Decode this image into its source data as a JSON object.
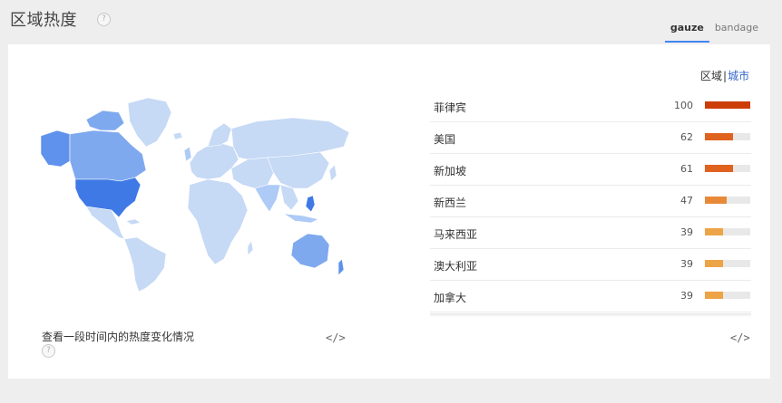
{
  "header": {
    "title": "区域热度",
    "help_glyph": "?"
  },
  "tabs": [
    {
      "label": "gauze",
      "active": true
    },
    {
      "label": "bandage",
      "active": false
    }
  ],
  "toggle": {
    "region": "区域",
    "separator": "|",
    "city": "城市"
  },
  "map": {
    "icon": "world-choropleth-map",
    "colors": {
      "land": "#c6d9f5",
      "light": "#aecbf7",
      "medium": "#7fa9ef",
      "strong": "#5e92ec",
      "dark": "#3f79e6",
      "border": "#ffffff"
    }
  },
  "rankings": [
    {
      "name": "菲律宾",
      "value": "100",
      "score": 100,
      "color": "#cc3d06"
    },
    {
      "name": "美国",
      "value": "62",
      "score": 62,
      "color": "#e0621f"
    },
    {
      "name": "新加坡",
      "value": "61",
      "score": 61,
      "color": "#e0621f"
    },
    {
      "name": "新西兰",
      "value": "47",
      "score": 47,
      "color": "#e8893a"
    },
    {
      "name": "马来西亚",
      "value": "39",
      "score": 39,
      "color": "#eda446"
    },
    {
      "name": "澳大利亚",
      "value": "39",
      "score": 39,
      "color": "#eda446"
    },
    {
      "name": "加拿大",
      "value": "39",
      "score": 39,
      "color": "#eda446"
    }
  ],
  "footer": {
    "text": "查看一段时间内的热度变化情况",
    "embed_label": "</>"
  }
}
